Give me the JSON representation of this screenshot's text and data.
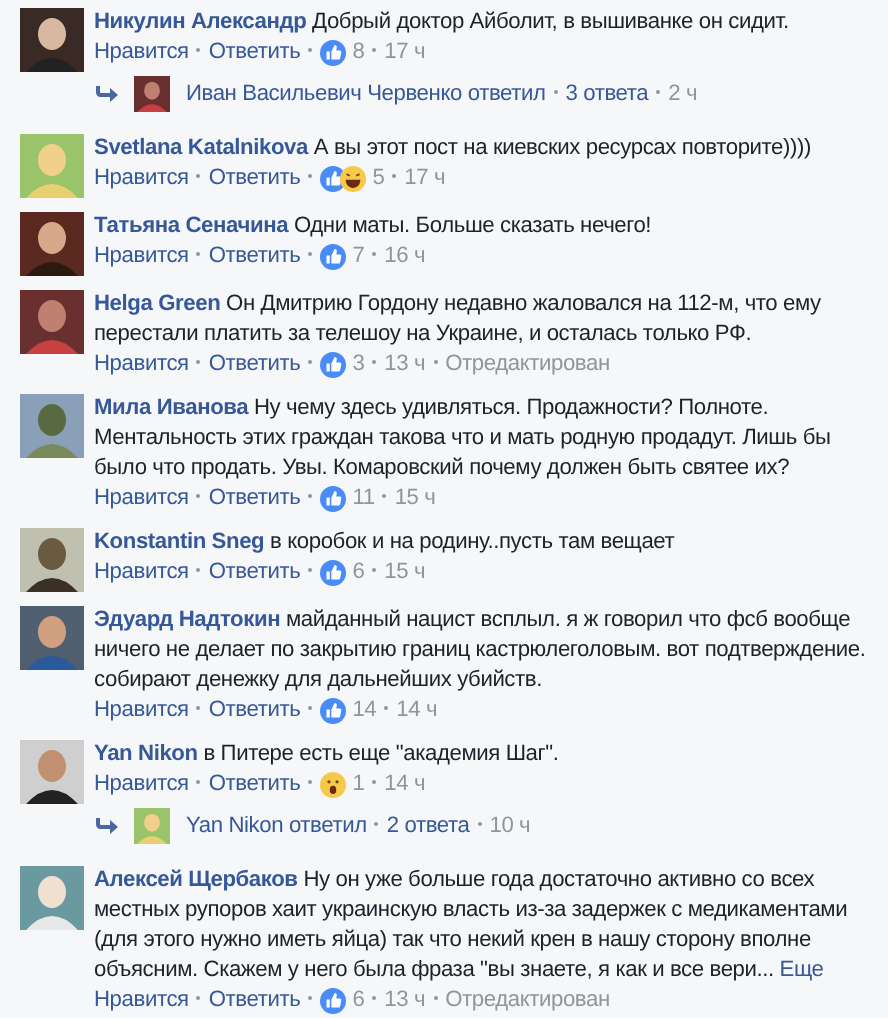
{
  "comments": [
    {
      "author": "Никулин Александр",
      "text": "Добрый доктор Айболит, в вышиванке он сидит.",
      "like": "Нравится",
      "reply": "Ответить",
      "reactions": [
        {
          "kind": "like"
        }
      ],
      "count": "8",
      "time": "17 ч",
      "thread": {
        "who": "Иван Васильевич Червенко ответил",
        "replies": "3 ответа",
        "time": "2 ч"
      }
    },
    {
      "author": "Svetlana Katalnikova",
      "text": "А вы этот пост на киевских ресурсах повторите))))",
      "like": "Нравится",
      "reply": "Ответить",
      "reactions": [
        {
          "kind": "like"
        },
        {
          "kind": "haha"
        }
      ],
      "count": "5",
      "time": "17 ч"
    },
    {
      "author": "Татьяна Сеначина",
      "text": "Одни маты. Больше сказать нечего!",
      "like": "Нравится",
      "reply": "Ответить",
      "reactions": [
        {
          "kind": "like"
        }
      ],
      "count": "7",
      "time": "16 ч"
    },
    {
      "author": "Helga Green",
      "text": "Он Дмитрию Гордону недавно жаловался на 112-м, что ему перестали платить за телешоу на Украине, и осталась только РФ.",
      "like": "Нравится",
      "reply": "Ответить",
      "reactions": [
        {
          "kind": "like"
        }
      ],
      "count": "3",
      "time": "13 ч",
      "edited": "Отредактирован"
    },
    {
      "author": "Мила Иванова",
      "text": "Ну чему здесь удивляться. Продажности? Полноте. Ментальность этих граждан такова что и мать родную продадут. Лишь бы было что продать. Увы. Комаровский почему должен быть святее их?",
      "like": "Нравится",
      "reply": "Ответить",
      "reactions": [
        {
          "kind": "like"
        }
      ],
      "count": "11",
      "time": "15 ч"
    },
    {
      "author": "Konstantin Sneg",
      "text": "в коробок и на родину..пусть там вещает",
      "like": "Нравится",
      "reply": "Ответить",
      "reactions": [
        {
          "kind": "like"
        }
      ],
      "count": "6",
      "time": "15 ч"
    },
    {
      "author": "Эдуард Надтокин",
      "text": "майданный нацист всплыл. я ж говорил что фсб вообще ничего не делает по закрытию границ кастрюлеголовым. вот подтверждение. собирают денежку для дальнейших убийств.",
      "like": "Нравится",
      "reply": "Ответить",
      "reactions": [
        {
          "kind": "like"
        }
      ],
      "count": "14",
      "time": "14 ч"
    },
    {
      "author": "Yan Nikon",
      "text": "в Питере есть еще \"академия Шаг\".",
      "like": "Нравится",
      "reply": "Ответить",
      "reactions": [
        {
          "kind": "wow"
        }
      ],
      "count": "1",
      "time": "14 ч",
      "thread": {
        "who": "Yan Nikon ответил",
        "replies": "2 ответа",
        "time": "10 ч"
      }
    },
    {
      "author": "Алексей Щербаков",
      "text": "Ну он уже больше года достаточно активно со всех местных рупоров хаит украинскую власть из-за задержек с медикаментами (для этого нужно иметь яйца) так что некий крен в нашу сторону вполне объясним. Скажем у него была фраза \"вы знаете, я как и все вери...",
      "more": "Еще",
      "like": "Нравится",
      "reply": "Ответить",
      "reactions": [
        {
          "kind": "like"
        }
      ],
      "count": "6",
      "time": "13 ч",
      "edited": "Отредактирован"
    }
  ]
}
